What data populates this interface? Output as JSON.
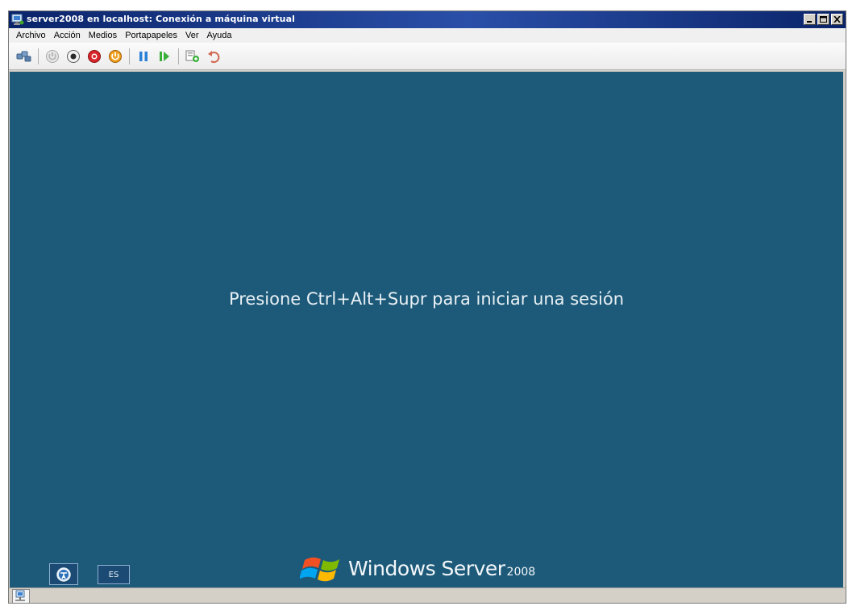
{
  "window": {
    "title": "server2008 en localhost: Conexión a máquina virtual"
  },
  "menu": {
    "items": [
      "Archivo",
      "Acción",
      "Medios",
      "Portapapeles",
      "Ver",
      "Ayuda"
    ]
  },
  "toolbar": {
    "buttons": [
      "ctrl-alt-del-icon",
      "start-icon",
      "turn-off-icon",
      "shut-down-icon",
      "save-state-icon",
      "pause-icon",
      "reset-icon",
      "snapshot-icon",
      "revert-icon"
    ]
  },
  "screen": {
    "message": "Presione Ctrl+Alt+Supr para iniciar una sesión",
    "background": "#1d5a7a",
    "language": "ES",
    "brand_name": "Windows Server",
    "brand_version": "2008"
  },
  "colors": {
    "titlebar": "#0a246a",
    "window": "#d4d0c8"
  }
}
